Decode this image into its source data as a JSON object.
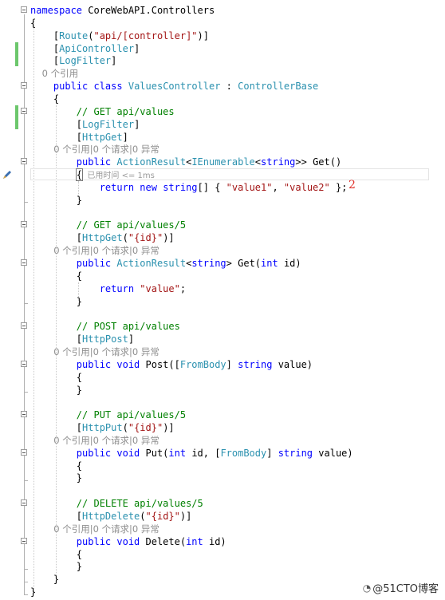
{
  "lines": [
    {
      "segments": [
        {
          "t": "namespace ",
          "c": "kw"
        },
        {
          "t": "CoreWebAPI.Controllers",
          "c": ""
        }
      ]
    },
    {
      "segments": [
        {
          "t": "{",
          "c": ""
        }
      ]
    },
    {
      "segments": [
        {
          "t": "    [",
          "c": ""
        },
        {
          "t": "Route",
          "c": "ty"
        },
        {
          "t": "(",
          "c": ""
        },
        {
          "t": "\"api/[controller]\"",
          "c": "st"
        },
        {
          "t": ")]",
          "c": ""
        }
      ]
    },
    {
      "segments": [
        {
          "t": "    [",
          "c": ""
        },
        {
          "t": "ApiController",
          "c": "ty"
        },
        {
          "t": "]",
          "c": ""
        }
      ]
    },
    {
      "segments": [
        {
          "t": "    [",
          "c": ""
        },
        {
          "t": "LogFilter",
          "c": "ty"
        },
        {
          "t": "]",
          "c": ""
        }
      ]
    },
    {
      "lens": "    0 个引用"
    },
    {
      "segments": [
        {
          "t": "    public ",
          "c": "kw"
        },
        {
          "t": "class ",
          "c": "kw"
        },
        {
          "t": "ValuesController",
          "c": "ty"
        },
        {
          "t": " : ",
          "c": ""
        },
        {
          "t": "ControllerBase",
          "c": "ty"
        }
      ]
    },
    {
      "segments": [
        {
          "t": "    {",
          "c": ""
        }
      ]
    },
    {
      "segments": [
        {
          "t": "        // GET api/values",
          "c": "cm"
        }
      ]
    },
    {
      "segments": [
        {
          "t": "        [",
          "c": ""
        },
        {
          "t": "LogFilter",
          "c": "ty"
        },
        {
          "t": "]",
          "c": ""
        }
      ]
    },
    {
      "segments": [
        {
          "t": "        [",
          "c": ""
        },
        {
          "t": "HttpGet",
          "c": "ty"
        },
        {
          "t": "]",
          "c": ""
        }
      ]
    },
    {
      "lens": "        0 个引用|0 个请求|0 异常"
    },
    {
      "segments": [
        {
          "t": "        public ",
          "c": "kw"
        },
        {
          "t": "ActionResult",
          "c": "ty"
        },
        {
          "t": "<",
          "c": ""
        },
        {
          "t": "IEnumerable",
          "c": "ty"
        },
        {
          "t": "<",
          "c": ""
        },
        {
          "t": "string",
          "c": "kw"
        },
        {
          "t": ">> Get()",
          "c": ""
        }
      ]
    },
    {
      "segments": [
        {
          "t": "        ",
          "c": ""
        },
        {
          "t": "{",
          "c": "brace-box"
        },
        {
          "t": "  已用时间 <= 1ms",
          "c": "perf"
        }
      ]
    },
    {
      "segments": [
        {
          "t": "            return ",
          "c": "kw"
        },
        {
          "t": "new ",
          "c": "kw"
        },
        {
          "t": "string",
          "c": "kw"
        },
        {
          "t": "[] { ",
          "c": ""
        },
        {
          "t": "\"value1\"",
          "c": "st"
        },
        {
          "t": ", ",
          "c": ""
        },
        {
          "t": "\"value2\"",
          "c": "st"
        },
        {
          "t": " };",
          "c": ""
        }
      ]
    },
    {
      "segments": [
        {
          "t": "        }",
          "c": ""
        }
      ]
    },
    {
      "segments": []
    },
    {
      "segments": [
        {
          "t": "        // GET api/values/5",
          "c": "cm"
        }
      ]
    },
    {
      "segments": [
        {
          "t": "        [",
          "c": ""
        },
        {
          "t": "HttpGet",
          "c": "ty"
        },
        {
          "t": "(",
          "c": ""
        },
        {
          "t": "\"{id}\"",
          "c": "st"
        },
        {
          "t": ")]",
          "c": ""
        }
      ]
    },
    {
      "lens": "        0 个引用|0 个请求|0 异常"
    },
    {
      "segments": [
        {
          "t": "        public ",
          "c": "kw"
        },
        {
          "t": "ActionResult",
          "c": "ty"
        },
        {
          "t": "<",
          "c": ""
        },
        {
          "t": "string",
          "c": "kw"
        },
        {
          "t": "> Get(",
          "c": ""
        },
        {
          "t": "int ",
          "c": "kw"
        },
        {
          "t": "id)",
          "c": ""
        }
      ]
    },
    {
      "segments": [
        {
          "t": "        {",
          "c": ""
        }
      ]
    },
    {
      "segments": [
        {
          "t": "            return ",
          "c": "kw"
        },
        {
          "t": "\"value\"",
          "c": "st"
        },
        {
          "t": ";",
          "c": ""
        }
      ]
    },
    {
      "segments": [
        {
          "t": "        }",
          "c": ""
        }
      ]
    },
    {
      "segments": []
    },
    {
      "segments": [
        {
          "t": "        // POST api/values",
          "c": "cm"
        }
      ]
    },
    {
      "segments": [
        {
          "t": "        [",
          "c": ""
        },
        {
          "t": "HttpPost",
          "c": "ty"
        },
        {
          "t": "]",
          "c": ""
        }
      ]
    },
    {
      "lens": "        0 个引用|0 个请求|0 异常"
    },
    {
      "segments": [
        {
          "t": "        public ",
          "c": "kw"
        },
        {
          "t": "void ",
          "c": "kw"
        },
        {
          "t": "Post([",
          "c": ""
        },
        {
          "t": "FromBody",
          "c": "ty"
        },
        {
          "t": "] ",
          "c": ""
        },
        {
          "t": "string ",
          "c": "kw"
        },
        {
          "t": "value)",
          "c": ""
        }
      ]
    },
    {
      "segments": [
        {
          "t": "        {",
          "c": ""
        }
      ]
    },
    {
      "segments": [
        {
          "t": "        }",
          "c": ""
        }
      ]
    },
    {
      "segments": []
    },
    {
      "segments": [
        {
          "t": "        // PUT api/values/5",
          "c": "cm"
        }
      ]
    },
    {
      "segments": [
        {
          "t": "        [",
          "c": ""
        },
        {
          "t": "HttpPut",
          "c": "ty"
        },
        {
          "t": "(",
          "c": ""
        },
        {
          "t": "\"{id}\"",
          "c": "st"
        },
        {
          "t": ")]",
          "c": ""
        }
      ]
    },
    {
      "lens": "        0 个引用|0 个请求|0 异常"
    },
    {
      "segments": [
        {
          "t": "        public ",
          "c": "kw"
        },
        {
          "t": "void ",
          "c": "kw"
        },
        {
          "t": "Put(",
          "c": ""
        },
        {
          "t": "int ",
          "c": "kw"
        },
        {
          "t": "id, [",
          "c": ""
        },
        {
          "t": "FromBody",
          "c": "ty"
        },
        {
          "t": "] ",
          "c": ""
        },
        {
          "t": "string ",
          "c": "kw"
        },
        {
          "t": "value)",
          "c": ""
        }
      ]
    },
    {
      "segments": [
        {
          "t": "        {",
          "c": ""
        }
      ]
    },
    {
      "segments": [
        {
          "t": "        }",
          "c": ""
        }
      ]
    },
    {
      "segments": []
    },
    {
      "segments": [
        {
          "t": "        // DELETE api/values/5",
          "c": "cm"
        }
      ]
    },
    {
      "segments": [
        {
          "t": "        [",
          "c": ""
        },
        {
          "t": "HttpDelete",
          "c": "ty"
        },
        {
          "t": "(",
          "c": ""
        },
        {
          "t": "\"{id}\"",
          "c": "st"
        },
        {
          "t": ")]",
          "c": ""
        }
      ]
    },
    {
      "lens": "        0 个引用|0 个请求|0 异常"
    },
    {
      "segments": [
        {
          "t": "        public ",
          "c": "kw"
        },
        {
          "t": "void ",
          "c": "kw"
        },
        {
          "t": "Delete(",
          "c": ""
        },
        {
          "t": "int ",
          "c": "kw"
        },
        {
          "t": "id)",
          "c": ""
        }
      ]
    },
    {
      "segments": [
        {
          "t": "        {",
          "c": ""
        }
      ]
    },
    {
      "segments": [
        {
          "t": "        }",
          "c": ""
        }
      ]
    },
    {
      "segments": [
        {
          "t": "    }",
          "c": ""
        }
      ]
    },
    {
      "segments": [
        {
          "t": "}",
          "c": ""
        }
      ]
    }
  ],
  "annotation": "2",
  "watermark": {
    "text": "@51CTO博客"
  },
  "gutter": {
    "breakpoint_icon": "pencil-icon"
  },
  "colors": {
    "keyword": "#0000ff",
    "type": "#2b91af",
    "string": "#a31515",
    "comment": "#008000",
    "change_bar": "#6cc76c",
    "annotation": "#e0302a"
  }
}
